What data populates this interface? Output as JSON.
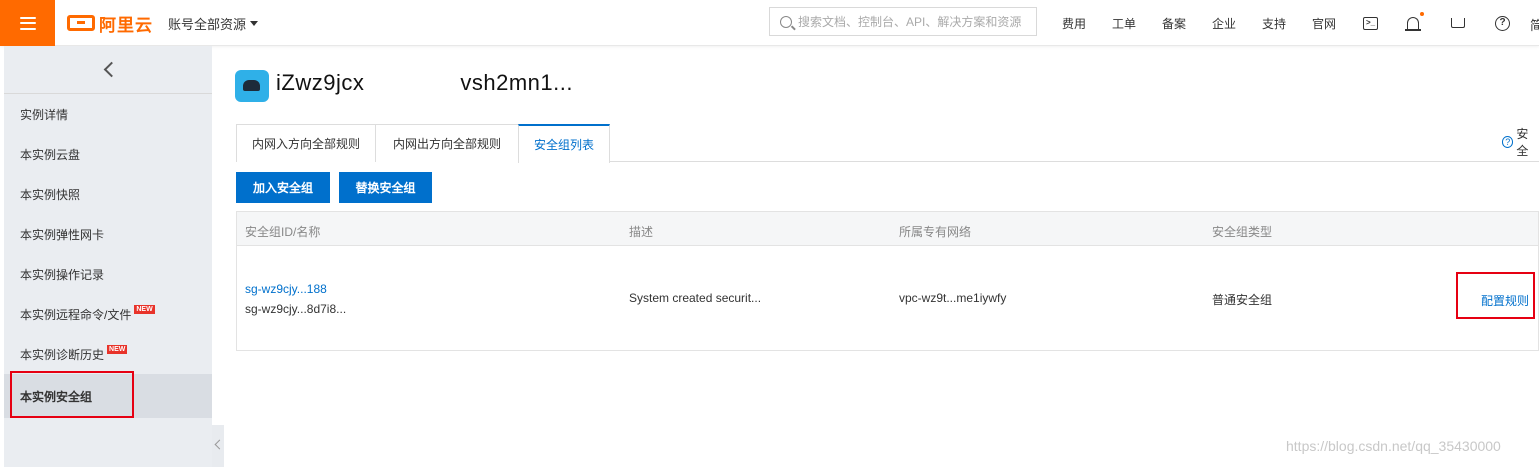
{
  "header": {
    "logo_text": "阿里云",
    "account_label": "账号全部资源",
    "search_placeholder": "搜索文档、控制台、API、解决方案和资源",
    "nav_links": [
      "费用",
      "工单",
      "备案",
      "企业",
      "支持",
      "官网"
    ],
    "more_label": "简",
    "icons": [
      "terminal-icon",
      "bell-icon",
      "cart-icon",
      "help-icon"
    ],
    "accent_color": "#ff6a00"
  },
  "sidebar": {
    "items": [
      {
        "label": "实例详情",
        "new": false
      },
      {
        "label": "本实例云盘",
        "new": false
      },
      {
        "label": "本实例快照",
        "new": false
      },
      {
        "label": "本实例弹性网卡",
        "new": false
      },
      {
        "label": "本实例操作记录",
        "new": false
      },
      {
        "label": "本实例远程命令/文件",
        "new": true
      },
      {
        "label": "本实例诊断历史",
        "new": true
      },
      {
        "label": "本实例安全组",
        "new": false,
        "active": true
      }
    ],
    "new_badge": "NEW"
  },
  "instance": {
    "title_start": "iZwz9jcx",
    "title_end": "vsh2mn1..."
  },
  "tabs": [
    "内网入方向全部规则",
    "内网出方向全部规则",
    "安全组列表"
  ],
  "active_tab": 2,
  "help_label": "安全",
  "buttons": {
    "add": "加入安全组",
    "replace": "替换安全组"
  },
  "table": {
    "headers": [
      "安全组ID/名称",
      "描述",
      "所属专有网络",
      "安全组类型"
    ],
    "rows": [
      {
        "id_link": "sg-wz9cjy...188",
        "name": "sg-wz9cjy...8d7i8...",
        "description": "System created securit...",
        "vpc": "vpc-wz9t...me1iywfy",
        "type": "普通安全组",
        "action": "配置规则"
      }
    ]
  },
  "watermark": "https://blog.csdn.net/qq_35430000"
}
